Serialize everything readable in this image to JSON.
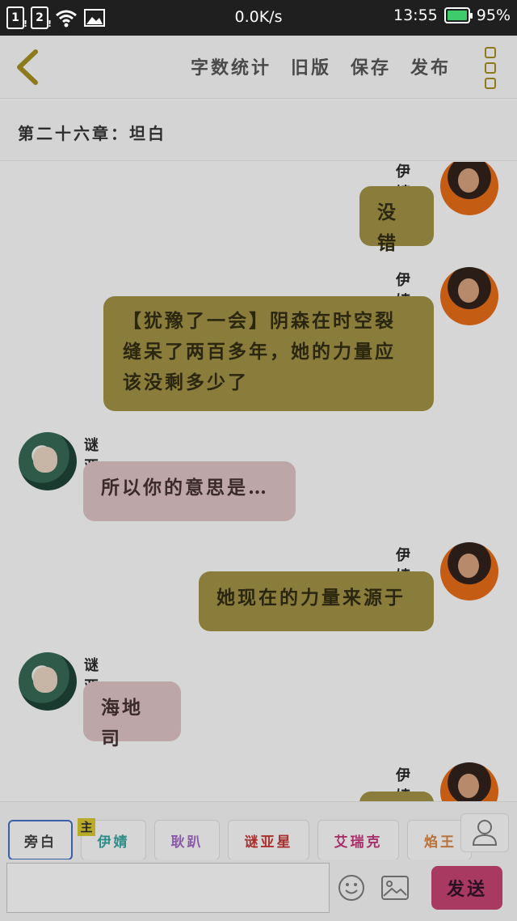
{
  "status_bar": {
    "sim1": "1",
    "sim2": "2",
    "net_speed": "0.0K/s",
    "time": "13:55",
    "battery": "95%"
  },
  "toolbar": {
    "actions": [
      "字数统计",
      "旧版",
      "保存",
      "发布"
    ]
  },
  "chapter": {
    "title": "第二十六章：坦白"
  },
  "messages": [
    {
      "speaker": "伊婧",
      "side": "right",
      "text": "没错"
    },
    {
      "speaker": "伊婧",
      "side": "right",
      "lines": [
        "【犹豫了一会】阴森在时空裂",
        "缝呆了两百多年，她的力量应",
        "该没剩多少了"
      ]
    },
    {
      "speaker": "谜亚星",
      "side": "left",
      "text": "所以你的意思是…"
    },
    {
      "speaker": "伊婧",
      "side": "right",
      "text": "她现在的力量来源于"
    },
    {
      "speaker": "谜亚星",
      "side": "left",
      "text": "海地司"
    },
    {
      "speaker": "伊婧",
      "side": "right",
      "text": ""
    }
  ],
  "roles": [
    {
      "label": "旁白",
      "color": "#3a3a3a"
    },
    {
      "label": "伊婧",
      "color": "#2f8c88"
    },
    {
      "label": "耿趴",
      "color": "#8a5aa8"
    },
    {
      "label": "谜亚星",
      "color": "#a8302e"
    },
    {
      "label": "艾瑞克",
      "color": "#a8306a"
    },
    {
      "label": "焰王",
      "color": "#b8703a"
    }
  ],
  "host_badge": "主",
  "send_label": "发送",
  "colors": {
    "yi_bubble": "#8a7d3c",
    "mi_bubble": "#bca6a8",
    "send_button": "#a83a62",
    "accent_back": "#8c7a1c"
  }
}
